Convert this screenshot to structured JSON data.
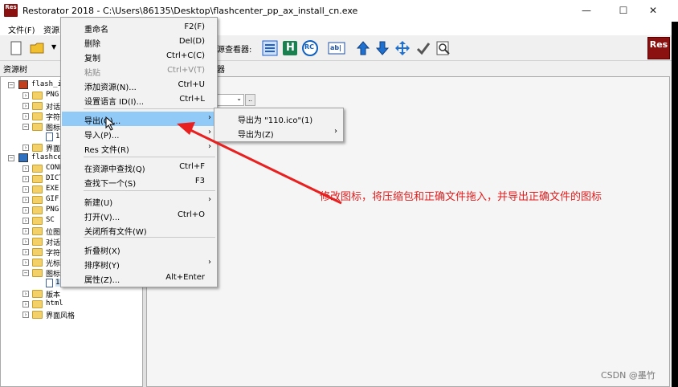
{
  "window": {
    "title": "Restorator 2018 - C:\\Users\\86135\\Desktop\\flashcenter_pp_ax_install_cn.exe",
    "app_icon_text": "Res",
    "minimize": "—",
    "maximize": "☐",
    "close": "✕"
  },
  "menubar": {
    "file": "文件(F)",
    "resource": "资源"
  },
  "toolbar": {
    "viewer_label": "资源查看器:",
    "logo_text": "Res",
    "h_glyph": "H",
    "rc_glyph": "RC",
    "ab_glyph": "ab|"
  },
  "tree": {
    "header": "资源树",
    "items": [
      {
        "label": "flash_i",
        "level": 0
      },
      {
        "label": "PNG",
        "level": 1
      },
      {
        "label": "对话",
        "level": 1
      },
      {
        "label": "字符",
        "level": 1
      },
      {
        "label": "图标",
        "level": 1
      },
      {
        "label": "1",
        "level": 2
      },
      {
        "label": "界面",
        "level": 1
      },
      {
        "label": "flashce",
        "level": 0
      },
      {
        "label": "CONF",
        "level": 1
      },
      {
        "label": "DICT",
        "level": 1
      },
      {
        "label": "EXE",
        "level": 1
      },
      {
        "label": "GIF",
        "level": 1
      },
      {
        "label": "PNG",
        "level": 1
      },
      {
        "label": "SC",
        "level": 1
      },
      {
        "label": "位图",
        "level": 1
      },
      {
        "label": "对话",
        "level": 1
      },
      {
        "label": "字符",
        "level": 1
      },
      {
        "label": "光标",
        "level": 1
      },
      {
        "label": "图标",
        "level": 1
      },
      {
        "label": "110",
        "level": 2
      },
      {
        "label": "版本",
        "level": 1
      },
      {
        "label": "html",
        "level": 1
      },
      {
        "label": "界面风格",
        "level": 1
      }
    ]
  },
  "right": {
    "header": "浏览器",
    "combo_value": "",
    "combo_btn": ".."
  },
  "context_menu": {
    "items": [
      {
        "label": "重命名",
        "shortcut": "F2(F)",
        "disabled": false
      },
      {
        "label": "删除",
        "shortcut": "Del(D)",
        "disabled": false
      },
      {
        "label": "复制",
        "shortcut": "Ctrl+C(C)",
        "disabled": false
      },
      {
        "label": "粘贴",
        "shortcut": "Ctrl+V(T)",
        "disabled": true
      },
      {
        "label": "添加资源(N)...",
        "shortcut": "Ctrl+U",
        "disabled": false
      },
      {
        "label": "设置语言 ID(I)...",
        "shortcut": "Ctrl+L",
        "disabled": false
      },
      {
        "label": "导出(Q)...",
        "shortcut": "",
        "submenu": true,
        "highlighted": true
      },
      {
        "label": "导入(P)...",
        "shortcut": "",
        "submenu": true
      },
      {
        "label": "Res 文件(R)",
        "shortcut": "",
        "submenu": true
      },
      {
        "label": "在资源中查找(Q)",
        "shortcut": "Ctrl+F"
      },
      {
        "label": "查找下一个(S)",
        "shortcut": "F3"
      },
      {
        "label": "新建(U)",
        "shortcut": "",
        "submenu": true
      },
      {
        "label": "打开(V)...",
        "shortcut": "Ctrl+O"
      },
      {
        "label": "关闭所有文件(W)",
        "shortcut": ""
      },
      {
        "label": "折叠树(X)",
        "shortcut": ""
      },
      {
        "label": "排序树(Y)",
        "shortcut": "",
        "submenu": true
      },
      {
        "label": "属性(Z)...",
        "shortcut": "Alt+Enter"
      }
    ],
    "submenu_arrow": "›"
  },
  "sub_menu": {
    "items": [
      {
        "label": "导出为 \"110.ico\"(1)"
      },
      {
        "label": "导出为(Z)",
        "submenu": true
      }
    ]
  },
  "annotation": "修改图标，将压缩包和正确文件拖入，并导出正确文件的图标",
  "watermark": "CSDN @墨竹",
  "colors": {
    "highlight": "#91c9f7",
    "annotation_red": "#e02020",
    "logo_red": "#8b1010"
  }
}
